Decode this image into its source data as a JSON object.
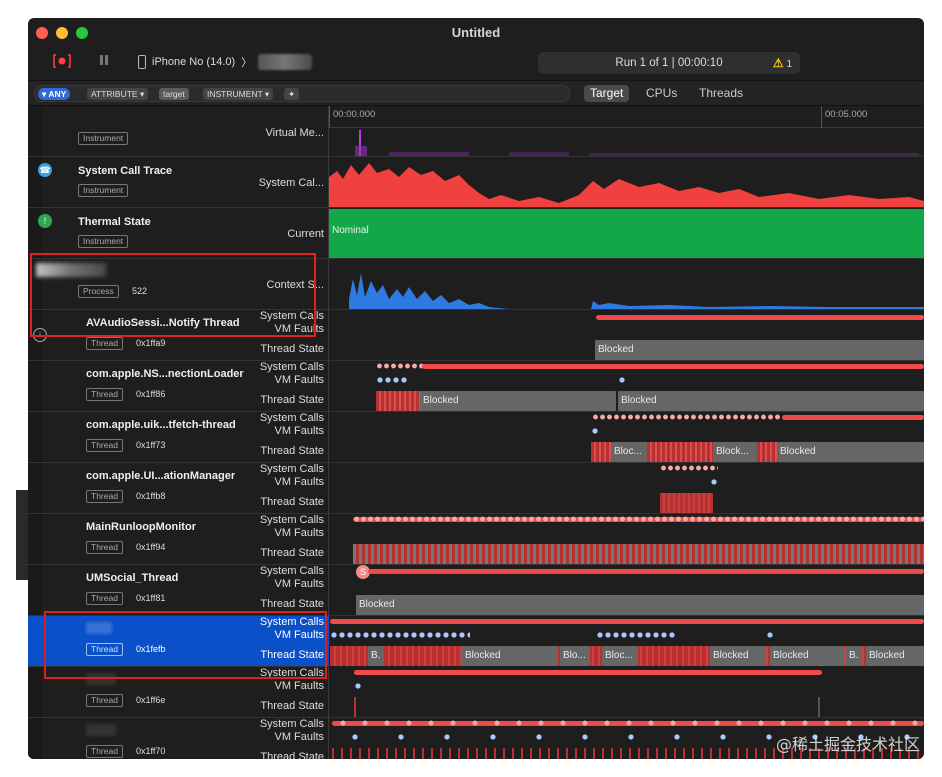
{
  "window": {
    "title": "Untitled"
  },
  "toolbar": {
    "device": "iPhone No (14.0)",
    "device_sep": "〉",
    "run_text": "Run 1 of 1  |  00:00:10",
    "warning_count": "1",
    "warning_icon": "⚠"
  },
  "filter": {
    "any": "▾ ANY",
    "attribute": "ATTRIBUTE ▾",
    "target_chip": "target",
    "instrument": "INSTRUMENT ▾",
    "plus": "✦"
  },
  "segments": {
    "target": "Target",
    "cpus": "CPUs",
    "threads": "Threads"
  },
  "ruler": {
    "t0": "00:00.000",
    "t5": "00:05.000"
  },
  "tracks": {
    "virtual_memory": {
      "tag": "Instrument",
      "label": "Virtual Me..."
    },
    "syscall": {
      "title": "System Call Trace",
      "tag": "Instrument",
      "label": "System Cal..."
    },
    "thermal": {
      "title": "Thermal State",
      "tag": "Instrument",
      "label": "Current",
      "state": "Nominal"
    },
    "process": {
      "tag": "Process",
      "pid": "522",
      "label": "Context S..."
    }
  },
  "labels": {
    "syscalls": "System Calls",
    "vm": "VM Faults",
    "state": "Thread State",
    "thread": "Thread"
  },
  "threads": [
    {
      "name": "AVAudioSessi...Notify Thread",
      "id": "0x1ffa9"
    },
    {
      "name": "com.apple.NS...nectionLoader",
      "id": "0x1ff86"
    },
    {
      "name": "com.apple.uik...tfetch-thread",
      "id": "0x1ff73"
    },
    {
      "name": "com.apple.UI...ationManager",
      "id": "0x1ffb8"
    },
    {
      "name": "MainRunloopMonitor",
      "id": "0x1ff94"
    },
    {
      "name": "UMSocial_Thread",
      "id": "0x1ff81"
    },
    {
      "name": "",
      "id": "0x1fefb"
    },
    {
      "name": "",
      "id": "0x1ff6e"
    },
    {
      "name": "",
      "id": "0x1ff70"
    }
  ],
  "states": {
    "blocked": "Blocked",
    "blocked_short": "Bloc...",
    "blocked_short2": "Block...",
    "blocked_short3": "Blo...",
    "blocked_short4": "Bloc...",
    "b": "B.",
    "s": "S"
  },
  "watermark": "@稀土掘金技术社区",
  "colors": {
    "accent": "#0a50c8",
    "red": "#f04a4a",
    "green": "#12a84a",
    "highlight": "#e02020"
  }
}
